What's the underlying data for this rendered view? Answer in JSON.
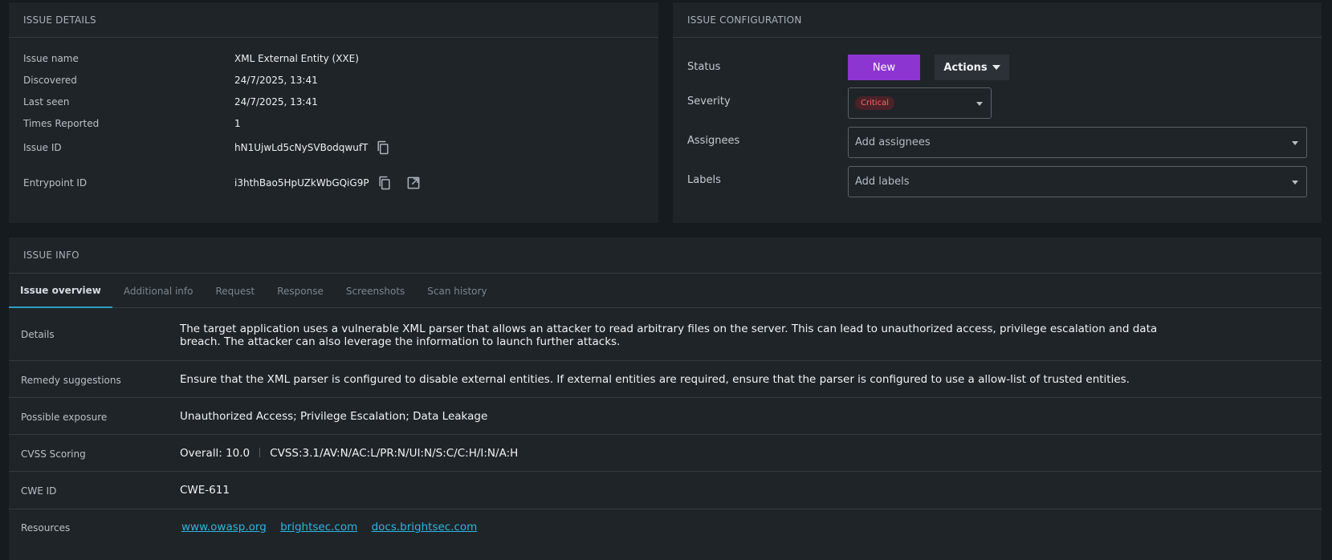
{
  "details": {
    "title": "ISSUE DETAILS",
    "rows": [
      {
        "label": "Issue name",
        "value": "XML External Entity (XXE)"
      },
      {
        "label": "Discovered",
        "value": "24/7/2025, 13:41"
      },
      {
        "label": "Last seen",
        "value": "24/7/2025, 13:41"
      },
      {
        "label": "Times Reported",
        "value": "1"
      },
      {
        "label": "Issue ID",
        "value": "hN1UjwLd5cNySVBodqwufT"
      },
      {
        "label": "Entrypoint ID",
        "value": "i3hthBao5HpUZkWbGQiG9P"
      }
    ]
  },
  "config": {
    "title": "ISSUE CONFIGURATION",
    "status_label": "Status",
    "status_value": "New",
    "actions_label": "Actions",
    "severity_label": "Severity",
    "severity_value": "Critical",
    "assignees_label": "Assignees",
    "assignees_placeholder": "Add assignees",
    "labels_label": "Labels",
    "labels_placeholder": "Add labels"
  },
  "info": {
    "title": "ISSUE INFO",
    "tabs": [
      "Issue overview",
      "Additional info",
      "Request",
      "Response",
      "Screenshots",
      "Scan history"
    ],
    "active_tab": "Issue overview",
    "rows": [
      {
        "label": "Details",
        "value": "The target application uses a vulnerable XML parser that allows an attacker to read arbitrary files on the server. This can lead to unauthorized access, privilege escalation and data breach. The attacker can also leverage the information to launch further attacks."
      },
      {
        "label": "Remedy suggestions",
        "value": "Ensure that the XML parser is configured to disable external entities. If external entities are required, ensure that the parser is configured to use a allow-list of trusted entities."
      },
      {
        "label": "Possible exposure",
        "value": "Unauthorized Access; Privilege Escalation; Data Leakage"
      },
      {
        "label": "CVSS Scoring",
        "overall": "Overall: 10.0",
        "vector": "CVSS:3.1/AV:N/AC:L/PR:N/UI:N/S:C/C:H/I:N/A:H"
      },
      {
        "label": "CWE ID",
        "value": "CWE-611"
      },
      {
        "label": "Resources",
        "links": [
          "www.owasp.org",
          "brightsec.com",
          "docs.brightsec.com"
        ]
      }
    ]
  },
  "colors": {
    "accent": "#8d35d1",
    "link": "#2fb4dd",
    "critical": "#f06a6a",
    "tab_underline": "#2c9ec4"
  },
  "icons": [
    "copy-icon",
    "external-link-icon",
    "chevron-down-icon"
  ]
}
